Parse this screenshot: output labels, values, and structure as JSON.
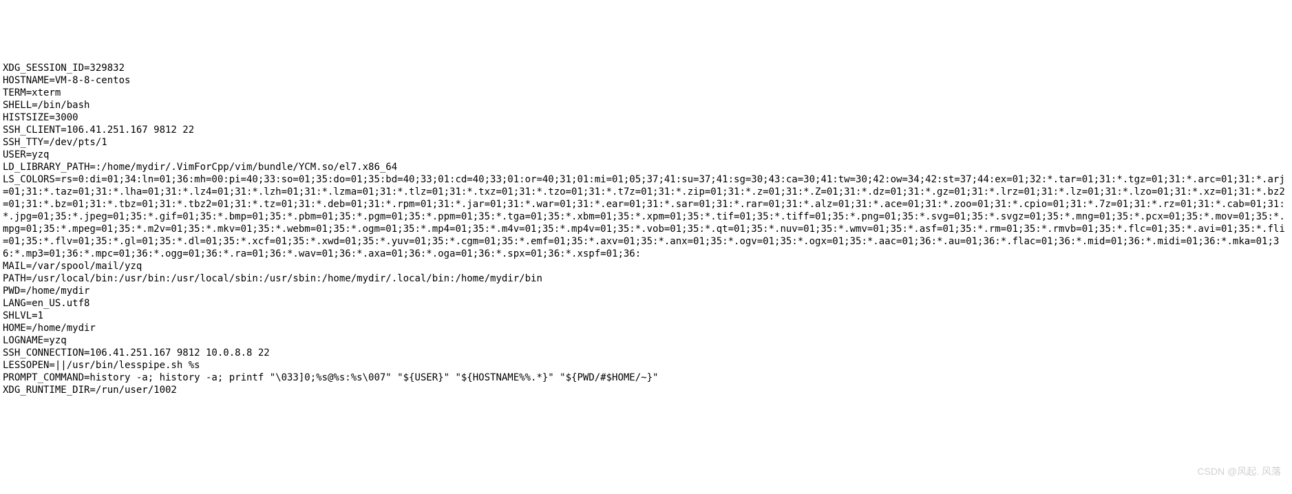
{
  "terminal": {
    "lines": [
      "XDG_SESSION_ID=329832",
      "HOSTNAME=VM-8-8-centos",
      "TERM=xterm",
      "SHELL=/bin/bash",
      "HISTSIZE=3000",
      "SSH_CLIENT=106.41.251.167 9812 22",
      "SSH_TTY=/dev/pts/1",
      "USER=yzq",
      "LD_LIBRARY_PATH=:/home/mydir/.VimForCpp/vim/bundle/YCM.so/el7.x86_64",
      "LS_COLORS=rs=0:di=01;34:ln=01;36:mh=00:pi=40;33:so=01;35:do=01;35:bd=40;33;01:cd=40;33;01:or=40;31;01:mi=01;05;37;41:su=37;41:sg=30;43:ca=30;41:tw=30;42:ow=34;42:st=37;44:ex=01;32:*.tar=01;31:*.tgz=01;31:*.arc=01;31:*.arj=01;31:*.taz=01;31:*.lha=01;31:*.lz4=01;31:*.lzh=01;31:*.lzma=01;31:*.tlz=01;31:*.txz=01;31:*.tzo=01;31:*.t7z=01;31:*.zip=01;31:*.z=01;31:*.Z=01;31:*.dz=01;31:*.gz=01;31:*.lrz=01;31:*.lz=01;31:*.lzo=01;31:*.xz=01;31:*.bz2=01;31:*.bz=01;31:*.tbz=01;31:*.tbz2=01;31:*.tz=01;31:*.deb=01;31:*.rpm=01;31:*.jar=01;31:*.war=01;31:*.ear=01;31:*.sar=01;31:*.rar=01;31:*.alz=01;31:*.ace=01;31:*.zoo=01;31:*.cpio=01;31:*.7z=01;31:*.rz=01;31:*.cab=01;31:*.jpg=01;35:*.jpeg=01;35:*.gif=01;35:*.bmp=01;35:*.pbm=01;35:*.pgm=01;35:*.ppm=01;35:*.tga=01;35:*.xbm=01;35:*.xpm=01;35:*.tif=01;35:*.tiff=01;35:*.png=01;35:*.svg=01;35:*.svgz=01;35:*.mng=01;35:*.pcx=01;35:*.mov=01;35:*.mpg=01;35:*.mpeg=01;35:*.m2v=01;35:*.mkv=01;35:*.webm=01;35:*.ogm=01;35:*.mp4=01;35:*.m4v=01;35:*.mp4v=01;35:*.vob=01;35:*.qt=01;35:*.nuv=01;35:*.wmv=01;35:*.asf=01;35:*.rm=01;35:*.rmvb=01;35:*.flc=01;35:*.avi=01;35:*.fli=01;35:*.flv=01;35:*.gl=01;35:*.dl=01;35:*.xcf=01;35:*.xwd=01;35:*.yuv=01;35:*.cgm=01;35:*.emf=01;35:*.axv=01;35:*.anx=01;35:*.ogv=01;35:*.ogx=01;35:*.aac=01;36:*.au=01;36:*.flac=01;36:*.mid=01;36:*.midi=01;36:*.mka=01;36:*.mp3=01;36:*.mpc=01;36:*.ogg=01;36:*.ra=01;36:*.wav=01;36:*.axa=01;36:*.oga=01;36:*.spx=01;36:*.xspf=01;36:",
      "MAIL=/var/spool/mail/yzq",
      "PATH=/usr/local/bin:/usr/bin:/usr/local/sbin:/usr/sbin:/home/mydir/.local/bin:/home/mydir/bin",
      "PWD=/home/mydir",
      "LANG=en_US.utf8",
      "SHLVL=1",
      "HOME=/home/mydir",
      "LOGNAME=yzq",
      "SSH_CONNECTION=106.41.251.167 9812 10.0.8.8 22",
      "LESSOPEN=||/usr/bin/lesspipe.sh %s",
      "PROMPT_COMMAND=history -a; history -a; printf \"\\033]0;%s@%s:%s\\007\" \"${USER}\" \"${HOSTNAME%%.*}\" \"${PWD/#$HOME/~}\"",
      "XDG_RUNTIME_DIR=/run/user/1002"
    ]
  },
  "watermark": "CSDN @风起. 风落"
}
